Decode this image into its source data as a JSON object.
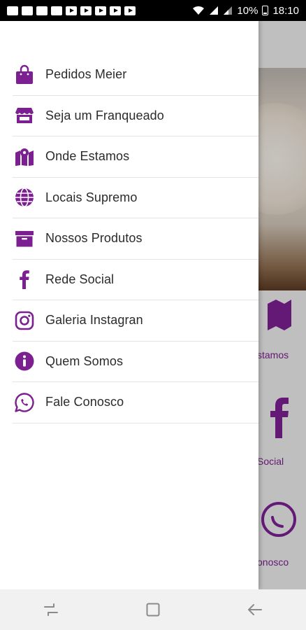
{
  "status_bar": {
    "battery": "10%",
    "time": "18:10"
  },
  "background": {
    "tiles": [
      {
        "label": "stamos",
        "icon": "map-icon"
      },
      {
        "label": "Social",
        "icon": "facebook-icon"
      },
      {
        "label": "onosco",
        "icon": "whatsapp-icon"
      }
    ]
  },
  "drawer": {
    "accent_color": "#7b1f91",
    "items": [
      {
        "label": "Pedidos Meier",
        "icon": "shopping-bag-icon"
      },
      {
        "label": "Seja um Franqueado",
        "icon": "store-icon"
      },
      {
        "label": "Onde Estamos",
        "icon": "map-icon"
      },
      {
        "label": "Locais Supremo",
        "icon": "globe-icon"
      },
      {
        "label": "Nossos Produtos",
        "icon": "archive-box-icon"
      },
      {
        "label": "Rede Social",
        "icon": "facebook-icon"
      },
      {
        "label": "Galeria Instagran",
        "icon": "instagram-icon"
      },
      {
        "label": "Quem Somos",
        "icon": "info-icon"
      },
      {
        "label": "Fale Conosco",
        "icon": "whatsapp-icon"
      }
    ]
  },
  "nav_bar": {
    "buttons": [
      "recent-apps-icon",
      "home-icon",
      "back-icon"
    ]
  }
}
